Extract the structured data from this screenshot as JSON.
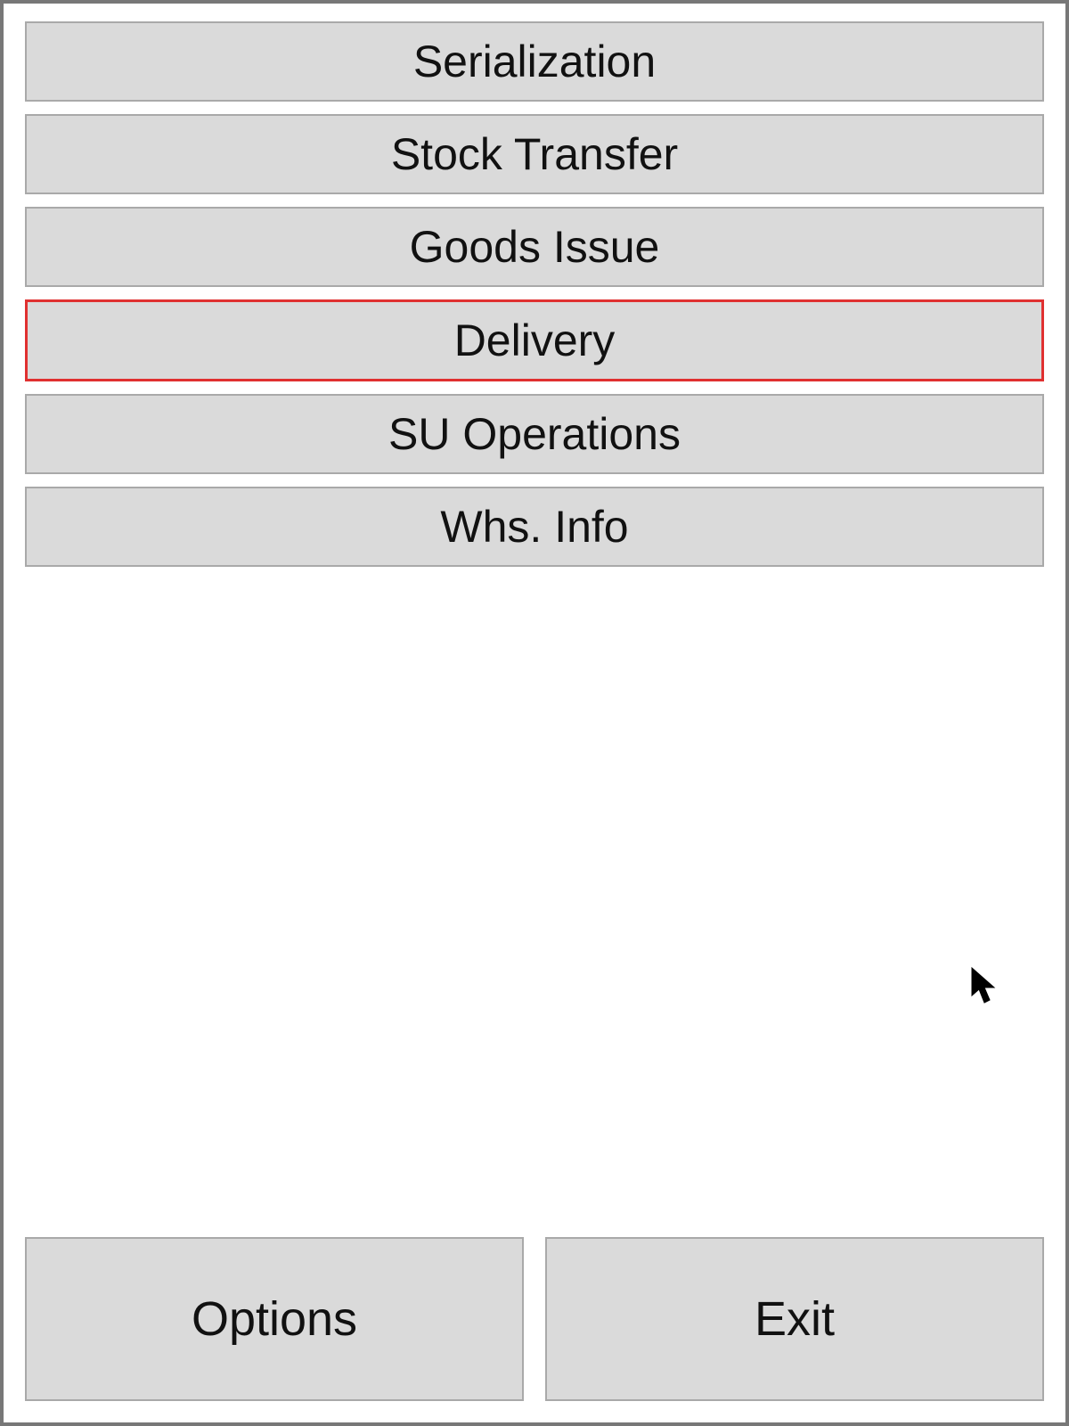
{
  "menu": {
    "items": [
      {
        "label": "Serialization",
        "selected": false
      },
      {
        "label": "Stock Transfer",
        "selected": false
      },
      {
        "label": "Goods Issue",
        "selected": false
      },
      {
        "label": "Delivery",
        "selected": true
      },
      {
        "label": "SU Operations",
        "selected": false
      },
      {
        "label": "Whs. Info",
        "selected": false
      }
    ]
  },
  "footer": {
    "options_label": "Options",
    "exit_label": "Exit"
  }
}
